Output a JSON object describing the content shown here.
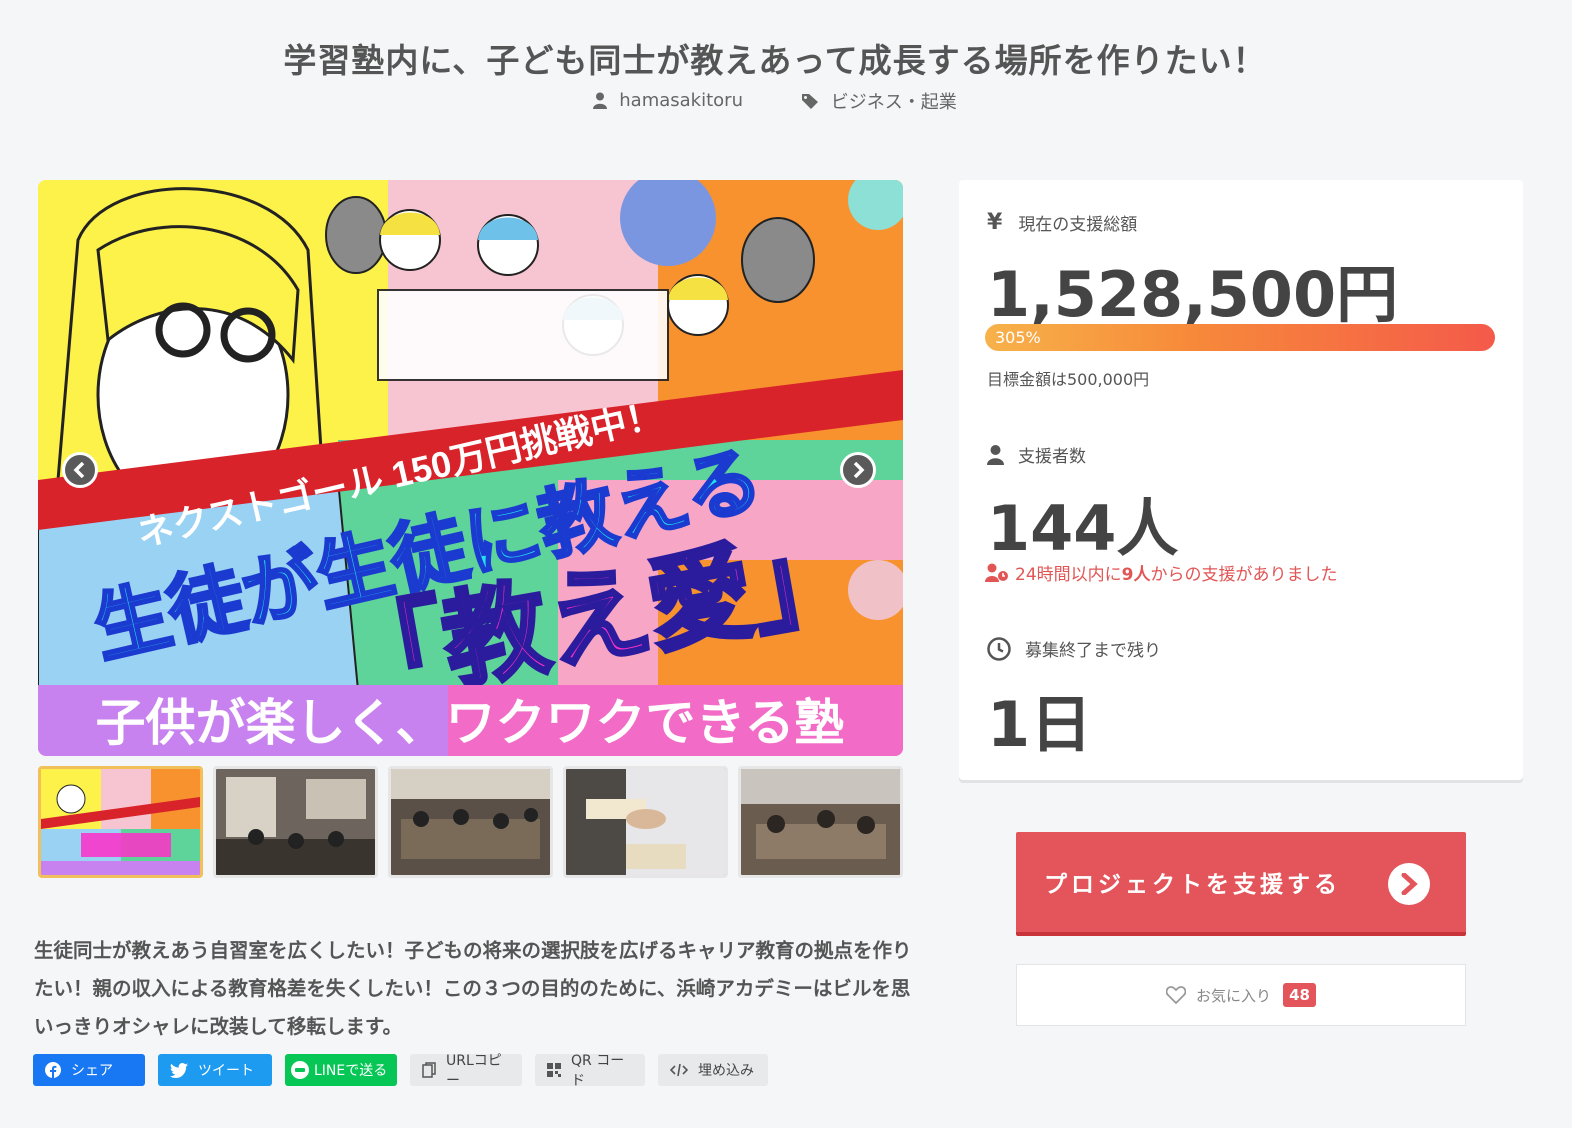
{
  "page": {
    "title": "学習塾内に、子ども同士が教えあって成長する場所を作りたい！",
    "author": "hamasakitoru",
    "category": "ビジネス・起業"
  },
  "hero": {
    "banner_top": "ネクストゴール 150万円挑戦中！",
    "headline": "生徒が生徒に教える",
    "title": "「教え愛」",
    "footer": "子供が楽しく、ワクワクできる塾"
  },
  "summary": "生徒同士が教えあう自習室を広くしたい！子どもの将来の選択肢を広げるキャリア教育の拠点を作りたい！親の収入による教育格差を失くしたい！この３つの目的のために、浜崎アカデミーはビルを思いっきりオシャレに改装して移転します。",
  "share": {
    "facebook": "シェア",
    "twitter": "ツイート",
    "line": "LINEで送る",
    "url_copy": "URLコピー",
    "qr": "QR コード",
    "embed": "埋め込み"
  },
  "stats": {
    "amount_label": "現在の支援総額",
    "amount": "1,528,500円",
    "progress_pct": "305%",
    "progress_value": 3.05,
    "goal_text": "目標金額は500,000円",
    "backers_label": "支援者数",
    "backers": "144人",
    "recent_prefix": "24時間以内に",
    "recent_count": "9人",
    "recent_suffix": "からの支援がありました",
    "remaining_label": "募集終了まで残り",
    "remaining": "1日"
  },
  "actions": {
    "support": "プロジェクトを支援する",
    "favorite": "お気に入り",
    "favorite_count": "48"
  },
  "colors": {
    "accent": "#e4555b",
    "facebook": "#1877f2",
    "twitter": "#1d9bf0",
    "line": "#06c755"
  }
}
